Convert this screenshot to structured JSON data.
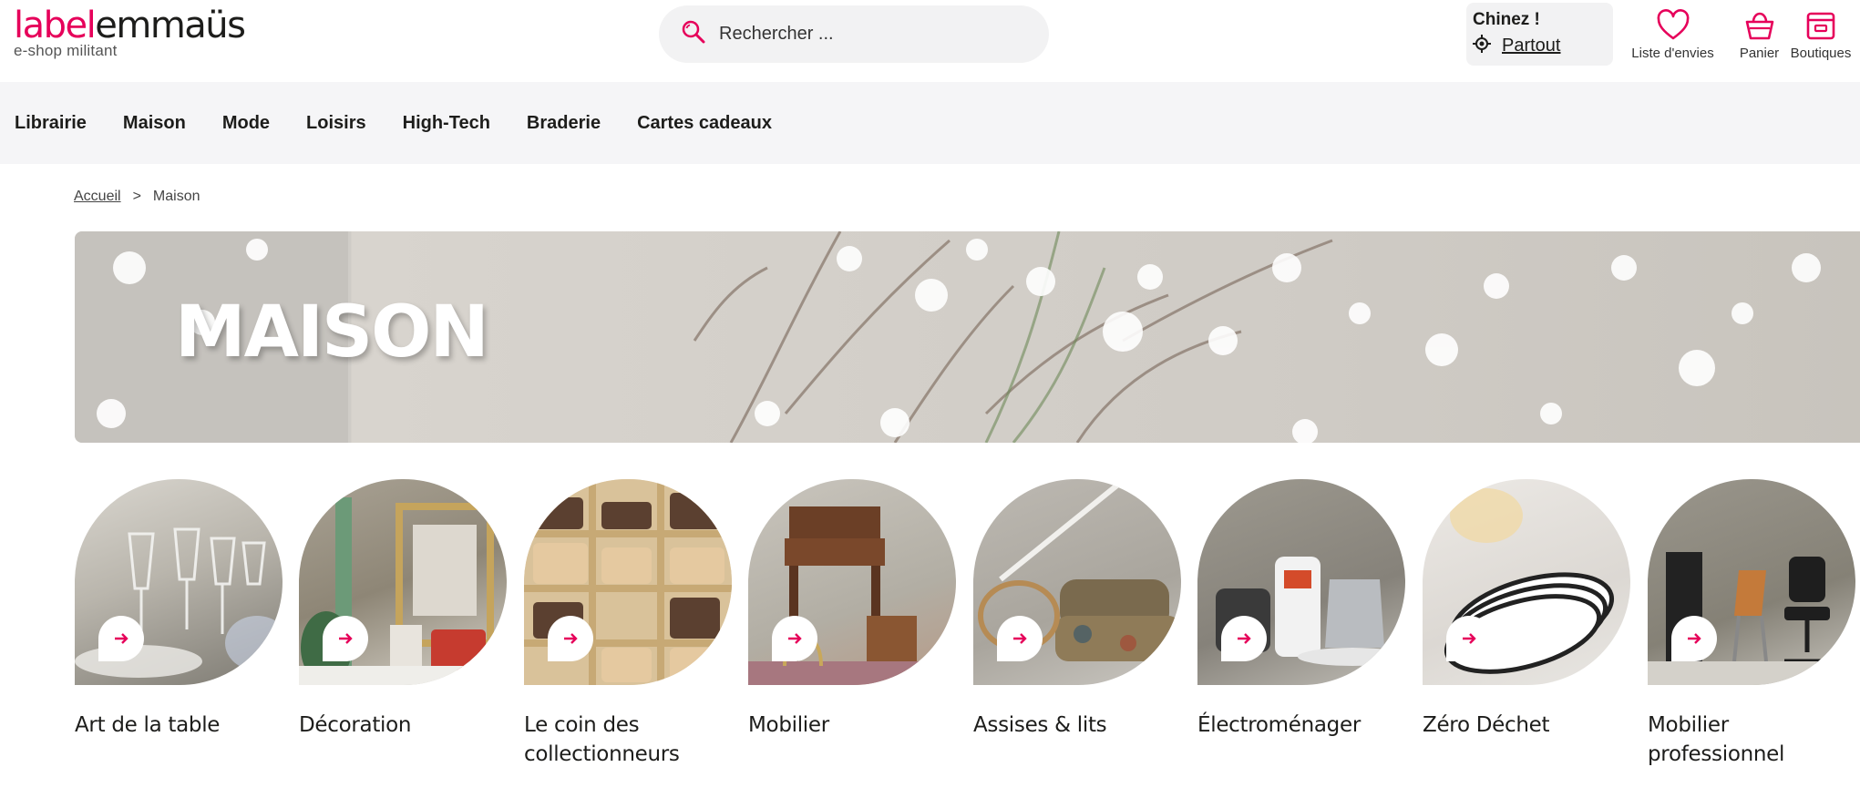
{
  "logo": {
    "part1": "label",
    "part2": "emmaüs",
    "tagline": "e-shop militant"
  },
  "search": {
    "placeholder": "Rechercher ..."
  },
  "chinez": {
    "title": "Chinez !",
    "location": "Partout"
  },
  "header_icons": {
    "wishlist": "Liste d'envies",
    "cart": "Panier",
    "shops": "Boutiques"
  },
  "nav": [
    "Librairie",
    "Maison",
    "Mode",
    "Loisirs",
    "High-Tech",
    "Braderie",
    "Cartes cadeaux"
  ],
  "breadcrumb": {
    "home": "Accueil",
    "separator": ">",
    "current": "Maison"
  },
  "banner": {
    "title": "MAISON"
  },
  "categories": [
    {
      "label": "Art de la table",
      "icon": "arrow-right-icon"
    },
    {
      "label": "Décoration",
      "icon": "arrow-right-icon"
    },
    {
      "label": "Le coin des collectionneurs",
      "icon": "arrow-right-icon"
    },
    {
      "label": "Mobilier",
      "icon": "arrow-right-icon"
    },
    {
      "label": "Assises & lits",
      "icon": "arrow-right-icon"
    },
    {
      "label": "Électroménager",
      "icon": "arrow-right-icon"
    },
    {
      "label": "Zéro Déchet",
      "icon": "arrow-right-icon"
    },
    {
      "label": "Mobilier professionnel",
      "icon": "arrow-right-icon"
    }
  ],
  "colors": {
    "accent": "#e6005a",
    "nav_bg": "#f5f5f7",
    "search_bg": "#f2f2f3"
  }
}
